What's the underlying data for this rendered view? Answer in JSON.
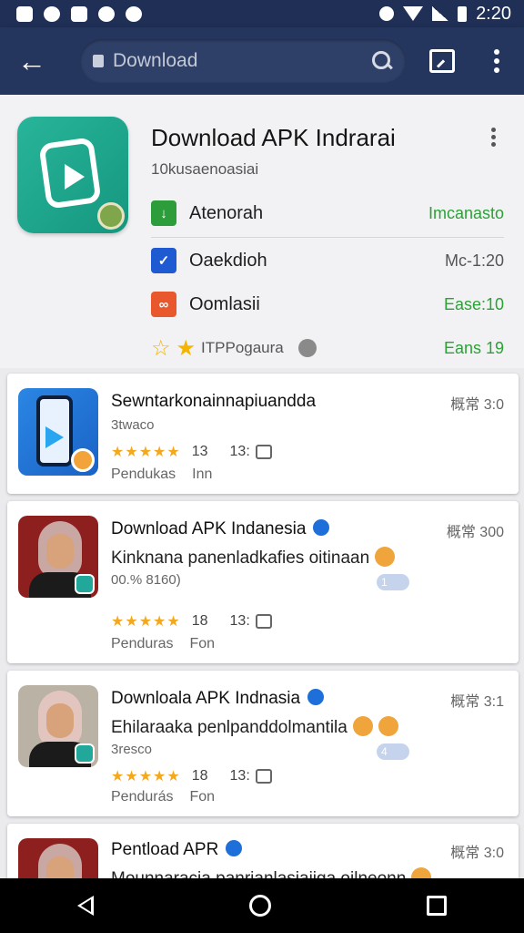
{
  "status_bar": {
    "time": "2:20"
  },
  "app_bar": {
    "search_placeholder": "Download"
  },
  "header": {
    "title": "Download APK Indrarai",
    "subtitle": "10kusaenoasiai",
    "rows": [
      {
        "label": "Atenorah",
        "value": "Imcanasto",
        "value_color": "#2aa235",
        "icon_color": "#2d9c3a",
        "icon": "download-icon"
      },
      {
        "label": "Oaekdioh",
        "value": "Mc-1:20",
        "value_color": "#555555",
        "icon_color": "#1e5ad1",
        "icon": "shield-icon"
      },
      {
        "label": "Oomlasii",
        "value": "Ease:10",
        "value_color": "#2aa235",
        "icon_color": "#e8582c",
        "icon": "puzzle-icon"
      }
    ],
    "rating_label": "ITPPogaura",
    "rating_value": "Eans 19"
  },
  "list": [
    {
      "title": "Sewntarkonainnapiuandda",
      "time": "概常 3:0",
      "meta": "3twaco",
      "stars": "★★★★★",
      "rating_count": "13",
      "likes": "13:",
      "foot_left": "Pendukas",
      "foot_right": "Inn"
    },
    {
      "title": "Download APK Indanesia",
      "time": "概常 300",
      "desc": "Kinknana panenladkafies oitinaan",
      "meta": "00.% 8160)",
      "react": "1",
      "stars": "★★★★★",
      "rating_count": "18",
      "likes": "13:",
      "foot_left": "Penduras",
      "foot_right": "Fon"
    },
    {
      "title": "Downloala APK Indnasia",
      "time": "概常 3:1",
      "desc": "Ehilaraaka penlpanddolmantila",
      "meta": "3resco",
      "react": "4",
      "stars": "★★★★★",
      "rating_count": "18",
      "likes": "13:",
      "foot_left": "Pendurás",
      "foot_right": "Fon"
    },
    {
      "title": "Pentload APR",
      "time": "概常 3:0",
      "desc": "Mounnaracia panrianlasiaiiga oilneonn"
    }
  ]
}
